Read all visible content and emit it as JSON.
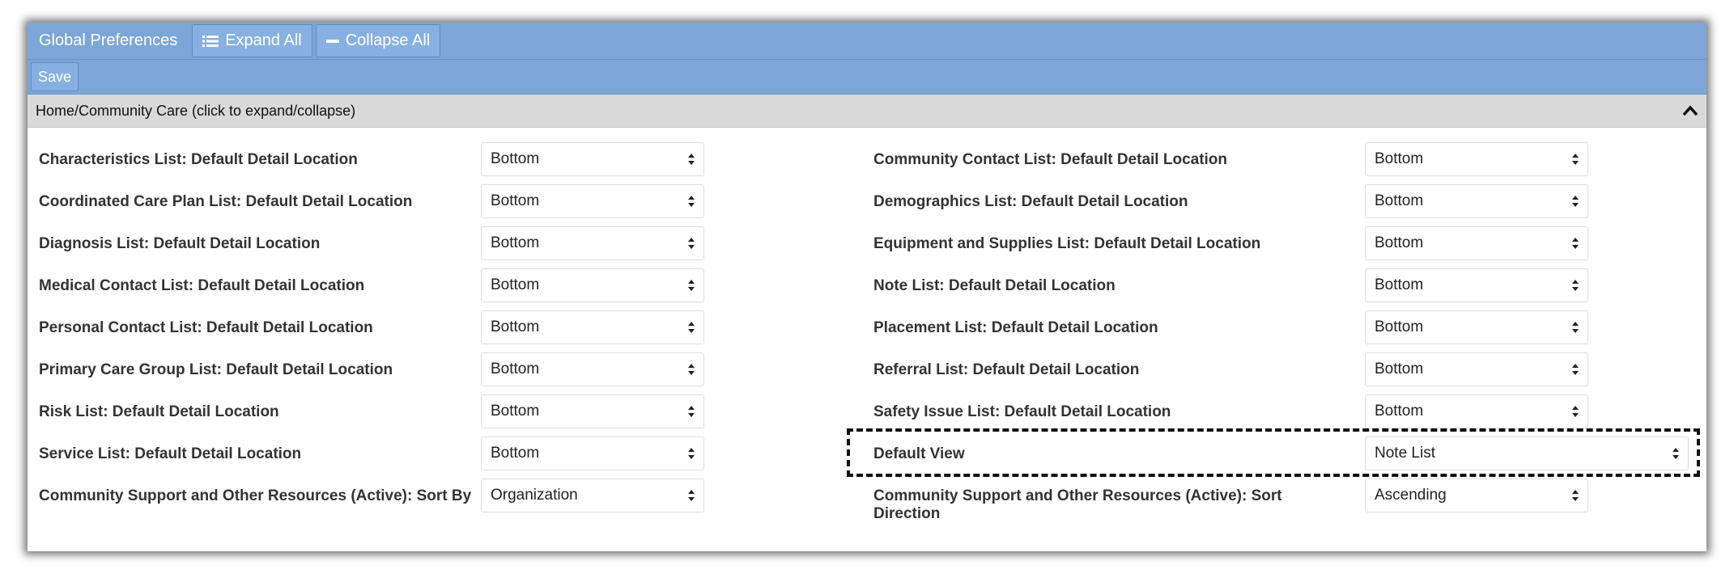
{
  "toolbar": {
    "title": "Global Preferences",
    "expand_all": "Expand All",
    "collapse_all": "Collapse All",
    "save": "Save"
  },
  "section": {
    "title": "Home/Community Care (click to expand/collapse)"
  },
  "rows": [
    {
      "left": {
        "label": "Characteristics List: Default Detail Location",
        "value": "Bottom"
      },
      "right": {
        "label": "Community Contact List: Default Detail Location",
        "value": "Bottom"
      }
    },
    {
      "left": {
        "label": "Coordinated Care Plan List: Default Detail Location",
        "value": "Bottom"
      },
      "right": {
        "label": "Demographics List: Default Detail Location",
        "value": "Bottom"
      }
    },
    {
      "left": {
        "label": "Diagnosis List: Default Detail Location",
        "value": "Bottom"
      },
      "right": {
        "label": "Equipment and Supplies List: Default Detail Location",
        "value": "Bottom"
      }
    },
    {
      "left": {
        "label": "Medical Contact List: Default Detail Location",
        "value": "Bottom"
      },
      "right": {
        "label": "Note List: Default Detail Location",
        "value": "Bottom"
      }
    },
    {
      "left": {
        "label": "Personal Contact List: Default Detail Location",
        "value": "Bottom"
      },
      "right": {
        "label": "Placement List: Default Detail Location",
        "value": "Bottom"
      }
    },
    {
      "left": {
        "label": "Primary Care Group List: Default Detail Location",
        "value": "Bottom"
      },
      "right": {
        "label": "Referral List: Default Detail Location",
        "value": "Bottom"
      }
    },
    {
      "left": {
        "label": "Risk List: Default Detail Location",
        "value": "Bottom"
      },
      "right": {
        "label": "Safety Issue List: Default Detail Location",
        "value": "Bottom"
      }
    },
    {
      "left": {
        "label": "Service List: Default Detail Location",
        "value": "Bottom"
      },
      "right": {
        "label": "Default View",
        "value": "Note List"
      }
    },
    {
      "left": {
        "label": "Community Support and Other Resources (Active): Sort By",
        "value": "Organization"
      },
      "right": {
        "label": "Community Support and Other Resources (Active): Sort Direction",
        "value": "Ascending"
      }
    }
  ]
}
